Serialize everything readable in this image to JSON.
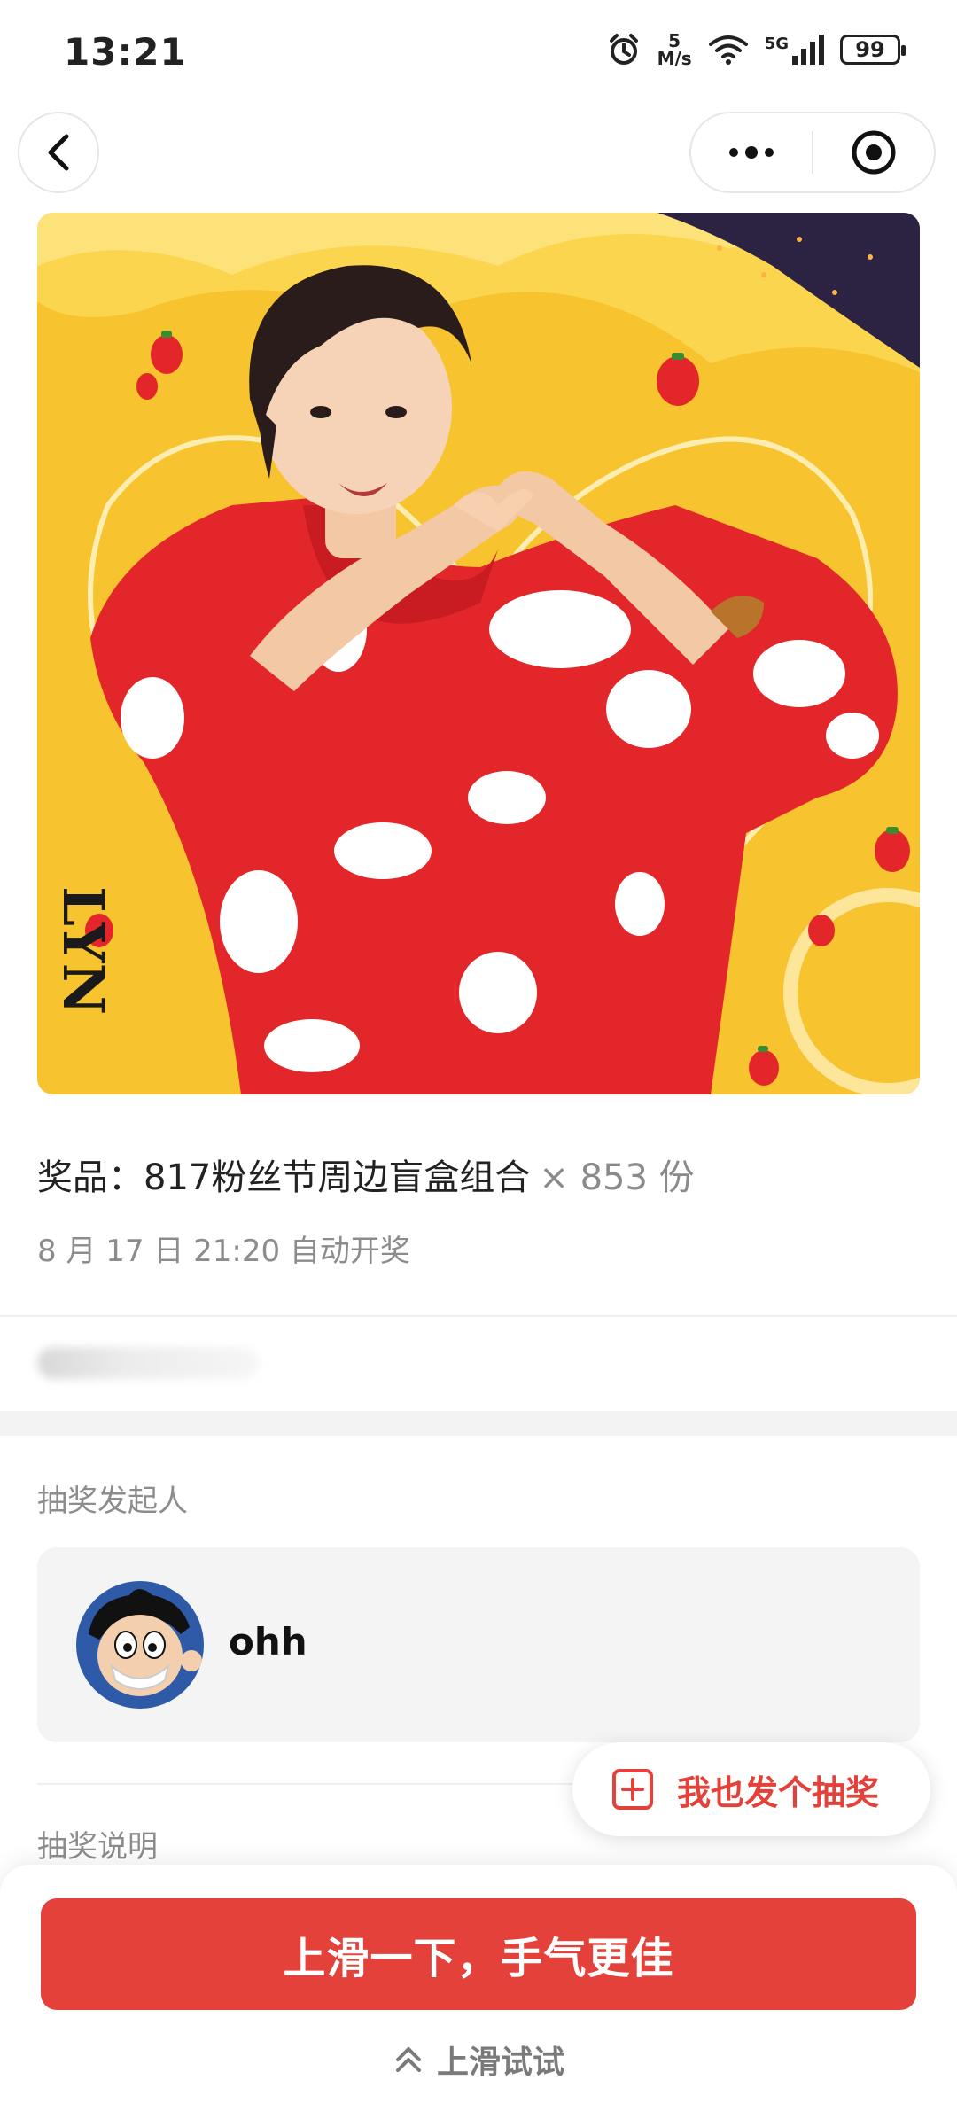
{
  "status_bar": {
    "time": "13:21",
    "net_speed_value": "5",
    "net_speed_unit": "M/s",
    "network": "5G",
    "battery": "99"
  },
  "nav": {
    "back_icon": "chevron-left-icon",
    "more_icon": "more-dots-icon",
    "close_icon": "target-circle-icon"
  },
  "prize": {
    "label": "奖品：817粉丝节周边盲盒组合",
    "count": "× 853 份",
    "draw_time": "8 月 17 日 21:20 自动开奖",
    "hero_caption": "LYN"
  },
  "organizer": {
    "section_label": "抽奖发起人",
    "name": "ohh"
  },
  "description": {
    "section_label": "抽奖说明"
  },
  "fab": {
    "label": "我也发个抽奖",
    "icon": "plus-square-icon"
  },
  "bottom": {
    "cta_label": "上滑一下，手气更佳",
    "hint_label": "上滑试试",
    "hint_icon": "double-chevron-up-icon"
  },
  "colors": {
    "accent": "#e3413a",
    "hero_bg": "#f7c32e",
    "shirt": "#e3262a"
  }
}
